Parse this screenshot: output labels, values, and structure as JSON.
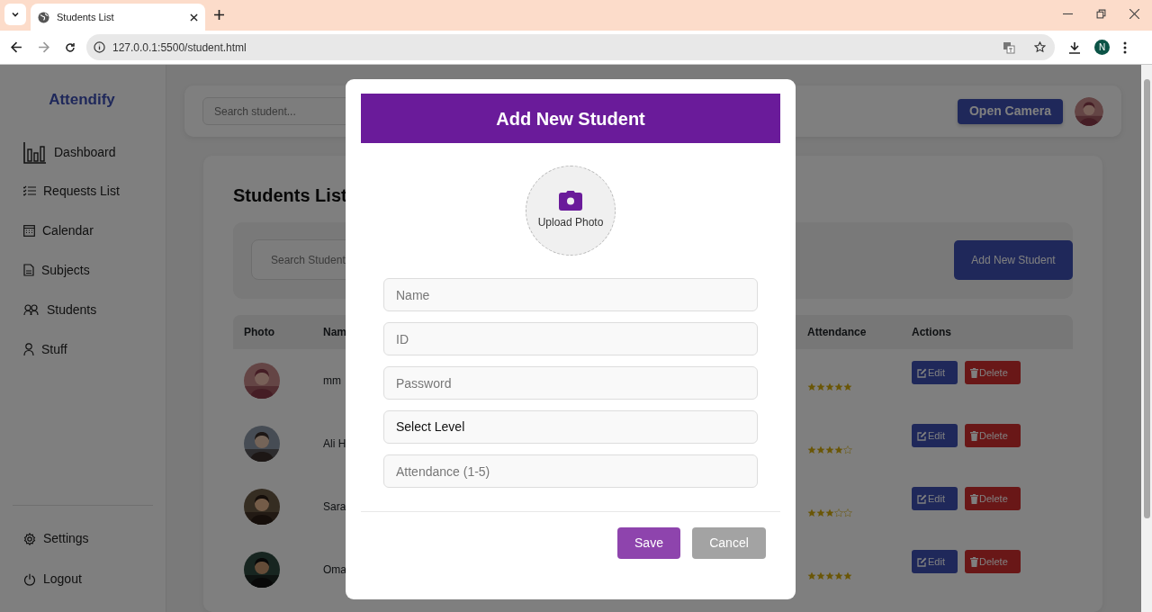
{
  "browser": {
    "tab_title": "Students List",
    "url": "127.0.0.1:5500/student.html",
    "profile_initial": "N",
    "forward_disabled": true
  },
  "sidebar": {
    "logo": "Attendify",
    "items": [
      {
        "label": "Dashboard",
        "kind": "chart"
      },
      {
        "label": "Requests List",
        "kind": "checklist"
      },
      {
        "label": "Calendar",
        "kind": "calendar"
      },
      {
        "label": "Subjects",
        "kind": "document"
      },
      {
        "label": "Students",
        "kind": "people"
      },
      {
        "label": "Stuff",
        "kind": "person"
      }
    ],
    "bottom_items": [
      {
        "label": "Settings",
        "kind": "gear"
      },
      {
        "label": "Logout",
        "kind": "power"
      }
    ]
  },
  "topbar": {
    "search_placeholder": "Search student...",
    "camera_button": "Open Camera"
  },
  "students": {
    "title": "Students List",
    "search_placeholder": "Search Student",
    "add_button": "Add New Student",
    "columns": [
      "Photo",
      "Nam",
      "Attendance",
      "Actions"
    ],
    "rows": [
      {
        "name": "mm",
        "stars": 5,
        "edit": "Edit",
        "delete": "Delete"
      },
      {
        "name": "Ali H",
        "stars": 4,
        "edit": "Edit",
        "delete": "Delete"
      },
      {
        "name": "Sara",
        "stars": 3,
        "edit": "Edit",
        "delete": "Delete"
      },
      {
        "name": "Oma",
        "stars": 5,
        "edit": "Edit",
        "delete": "Delete"
      }
    ]
  },
  "modal": {
    "title": "Add New Student",
    "upload_label": "Upload Photo",
    "fields": [
      {
        "kind": "input",
        "placeholder": "Name"
      },
      {
        "kind": "input",
        "placeholder": "ID"
      },
      {
        "kind": "input",
        "placeholder": "Password"
      },
      {
        "kind": "select",
        "value": "Select Level"
      },
      {
        "kind": "input",
        "placeholder": "Attendance (1-5)"
      }
    ],
    "buttons": [
      {
        "kind": "primary",
        "label": "Save"
      },
      {
        "kind": "secondary",
        "label": "Cancel"
      }
    ]
  }
}
